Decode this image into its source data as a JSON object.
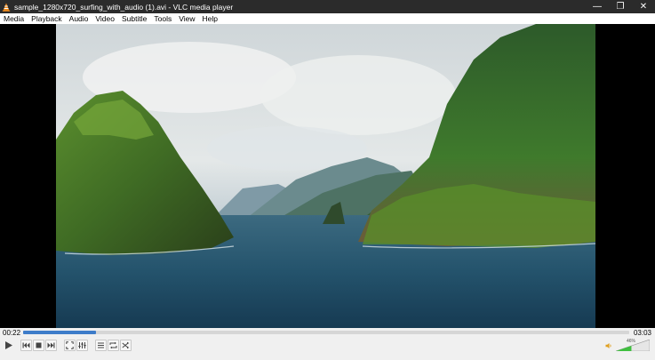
{
  "window": {
    "title": "sample_1280x720_surfing_with_audio (1).avi - VLC media player",
    "minimize_glyph": "—",
    "maximize_glyph": "❐",
    "close_glyph": "✕"
  },
  "menu": {
    "items": [
      "Media",
      "Playback",
      "Audio",
      "Video",
      "Subtitle",
      "Tools",
      "View",
      "Help"
    ]
  },
  "playback": {
    "elapsed": "00:22",
    "total": "03:03",
    "progress_fraction": 0.12
  },
  "volume": {
    "label": "46%",
    "level_fraction": 0.46
  },
  "icons": {
    "app": "vlc-cone-icon",
    "play": "play-icon",
    "prev": "previous-icon",
    "stop": "stop-icon",
    "next": "next-icon",
    "fullscreen": "fullscreen-icon",
    "extended": "equalizer-icon",
    "playlist": "playlist-icon",
    "loop": "loop-icon",
    "shuffle": "shuffle-icon",
    "volume": "speaker-icon"
  },
  "colors": {
    "titlebar": "#2b2b2b",
    "seek_fill": "#3d7cc9",
    "volume_fill": "#3fbf3f",
    "vlc_orange": "#f28c1c"
  }
}
